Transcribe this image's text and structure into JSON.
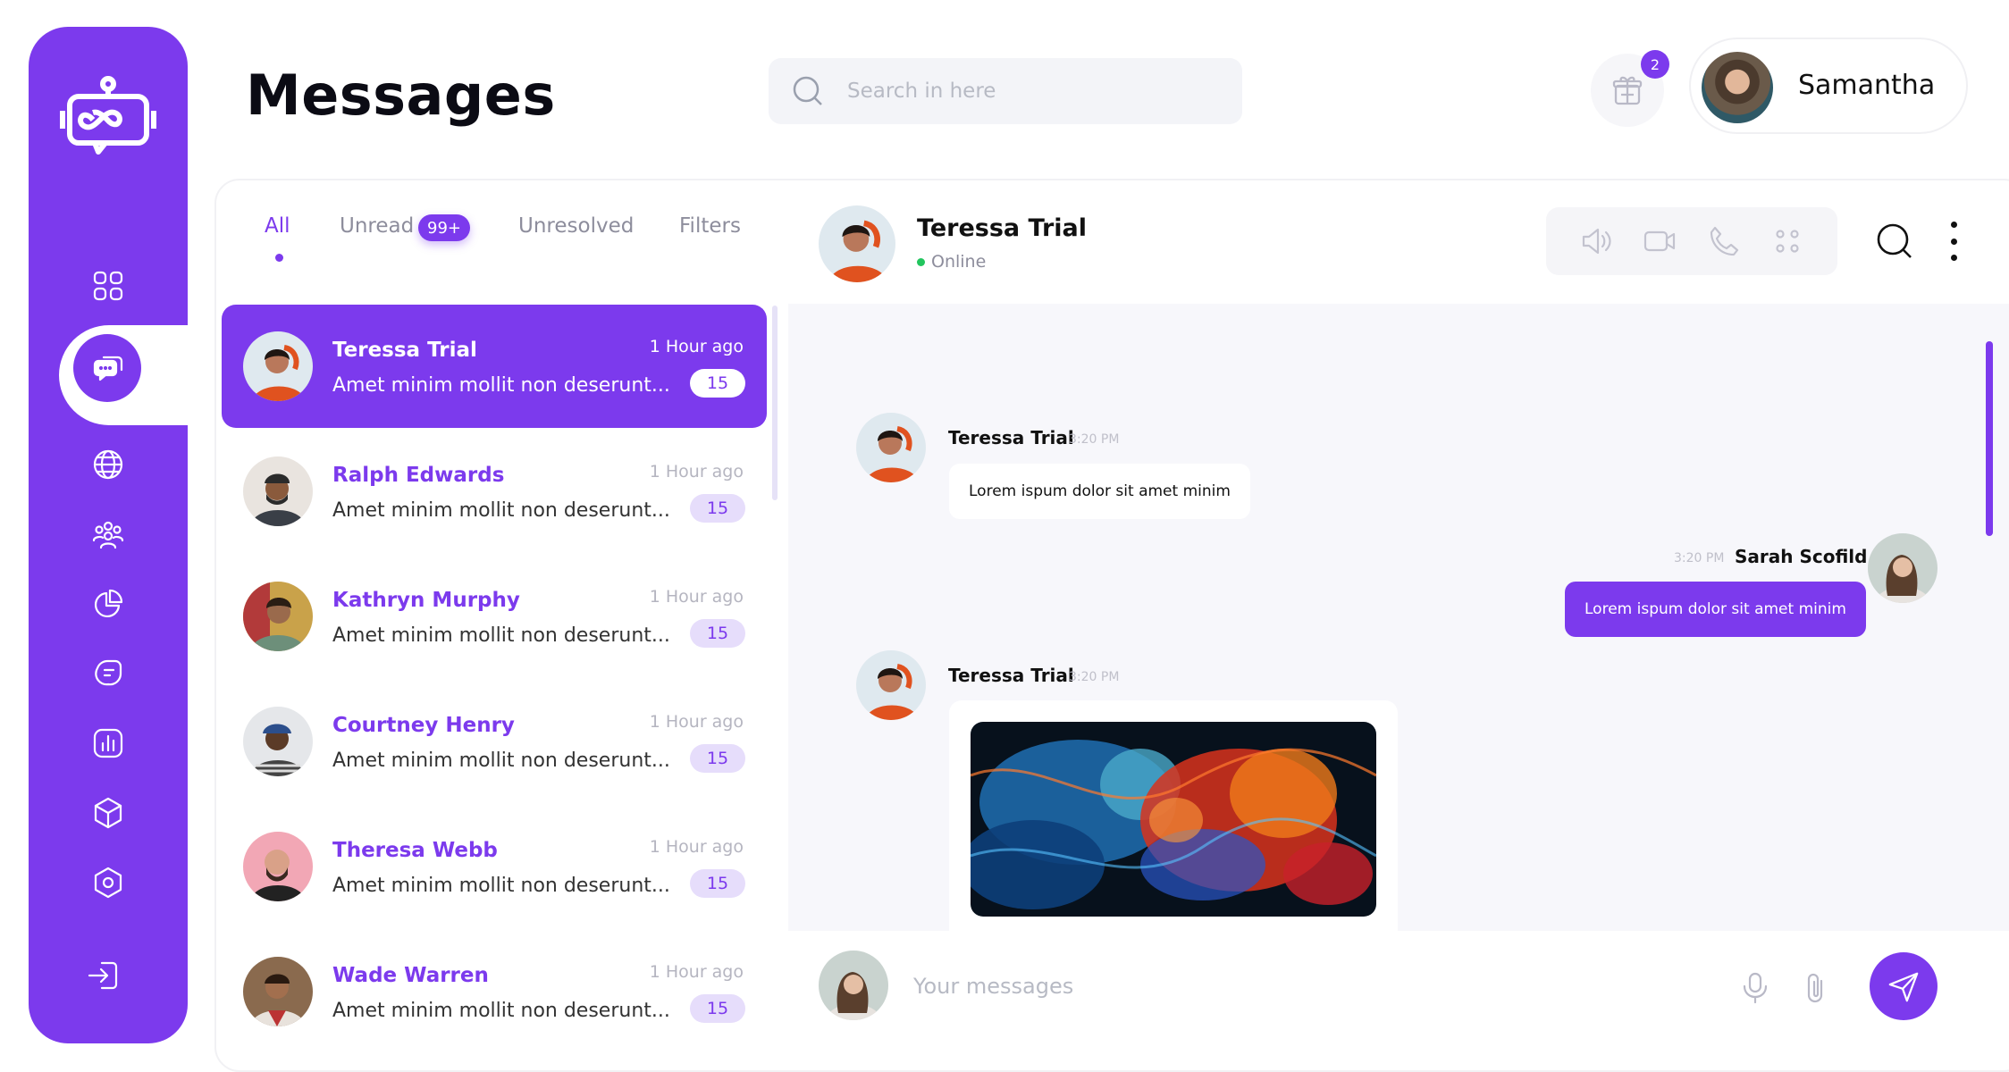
{
  "page": {
    "title": "Messages"
  },
  "search": {
    "placeholder": "Search in here"
  },
  "notifications": {
    "count": "2",
    "icon": "gift-icon"
  },
  "user": {
    "name": "Samantha"
  },
  "tabs": [
    {
      "label": "All",
      "active": true
    },
    {
      "label": "Unread",
      "badge": "99+"
    },
    {
      "label": "Unresolved"
    },
    {
      "label": "Filters"
    }
  ],
  "conversations": [
    {
      "name": "Teressa Trial",
      "preview": "Amet minim mollit non deserunt...",
      "time": "1 Hour ago",
      "count": "15",
      "active": true
    },
    {
      "name": "Ralph Edwards",
      "preview": "Amet minim mollit non deserunt...",
      "time": "1 Hour ago",
      "count": "15"
    },
    {
      "name": "Kathryn Murphy",
      "preview": "Amet minim mollit non deserunt...",
      "time": "1 Hour ago",
      "count": "15"
    },
    {
      "name": "Courtney Henry",
      "preview": "Amet minim mollit non deserunt...",
      "time": "1 Hour ago",
      "count": "15"
    },
    {
      "name": "Theresa Webb",
      "preview": "Amet minim mollit non deserunt...",
      "time": "1 Hour ago",
      "count": "15"
    },
    {
      "name": "Wade Warren",
      "preview": "Amet minim mollit non deserunt...",
      "time": "1 Hour ago",
      "count": "15"
    }
  ],
  "chat": {
    "contact_name": "Teressa Trial",
    "status": "Online",
    "messages": [
      {
        "sender": "Teressa Trial",
        "time": "3:20 PM",
        "text": "Lorem ispum dolor sit amet minim",
        "direction": "in"
      },
      {
        "sender": "Sarah Scofild",
        "time": "3:20 PM",
        "text": "Lorem ispum dolor sit amet minim",
        "direction": "out"
      },
      {
        "sender": "Teressa Trial",
        "time": "3:20 PM",
        "type": "image",
        "direction": "in"
      }
    ]
  },
  "composer": {
    "placeholder": "Your messages"
  },
  "sidebar": {
    "items": [
      "dashboard-grid-icon",
      "chat-icon",
      "globe-icon",
      "team-icon",
      "pie-chart-icon",
      "sticker-icon",
      "bar-chart-icon",
      "box-icon",
      "settings-hex-icon",
      "logout-icon"
    ]
  },
  "colors": {
    "accent": "#7c3aed",
    "online": "#22c55e"
  }
}
